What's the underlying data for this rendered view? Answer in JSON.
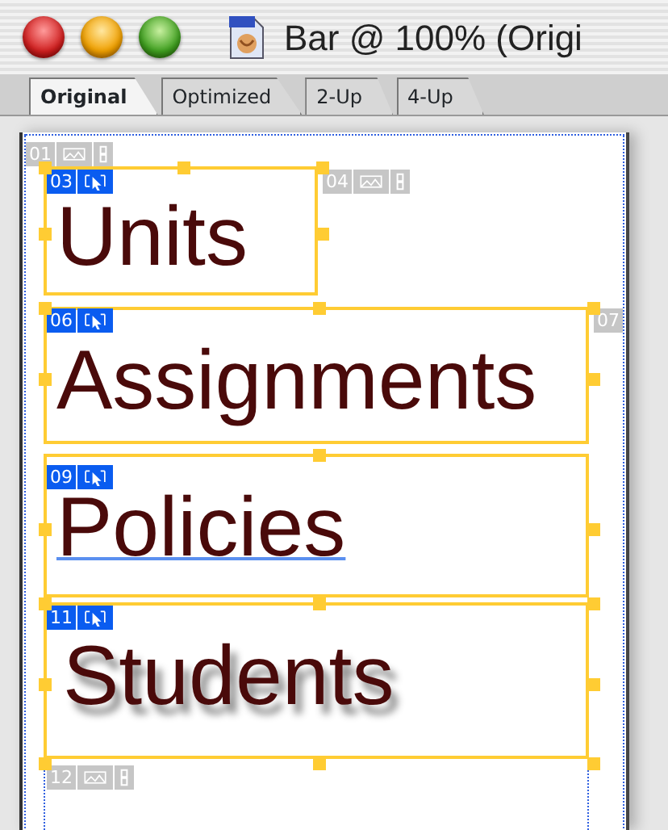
{
  "window": {
    "title": "Bar @ 100% (Origi"
  },
  "tabs": [
    {
      "label": "Original",
      "selected": true
    },
    {
      "label": "Optimized",
      "selected": false
    },
    {
      "label": "2-Up",
      "selected": false
    },
    {
      "label": "4-Up",
      "selected": false
    }
  ],
  "slices": [
    {
      "number": "01",
      "kind": "auto"
    },
    {
      "number": "03",
      "kind": "user",
      "text": "Units",
      "underlined": false,
      "shadowed": false
    },
    {
      "number": "04",
      "kind": "auto"
    },
    {
      "number": "06",
      "kind": "user",
      "text": "Assignments",
      "underlined": false,
      "shadowed": false
    },
    {
      "number": "07",
      "kind": "auto"
    },
    {
      "number": "09",
      "kind": "user",
      "text": "Policies",
      "underlined": true,
      "shadowed": false
    },
    {
      "number": "11",
      "kind": "user",
      "text": "Students",
      "underlined": false,
      "shadowed": true
    },
    {
      "number": "12",
      "kind": "auto"
    }
  ]
}
